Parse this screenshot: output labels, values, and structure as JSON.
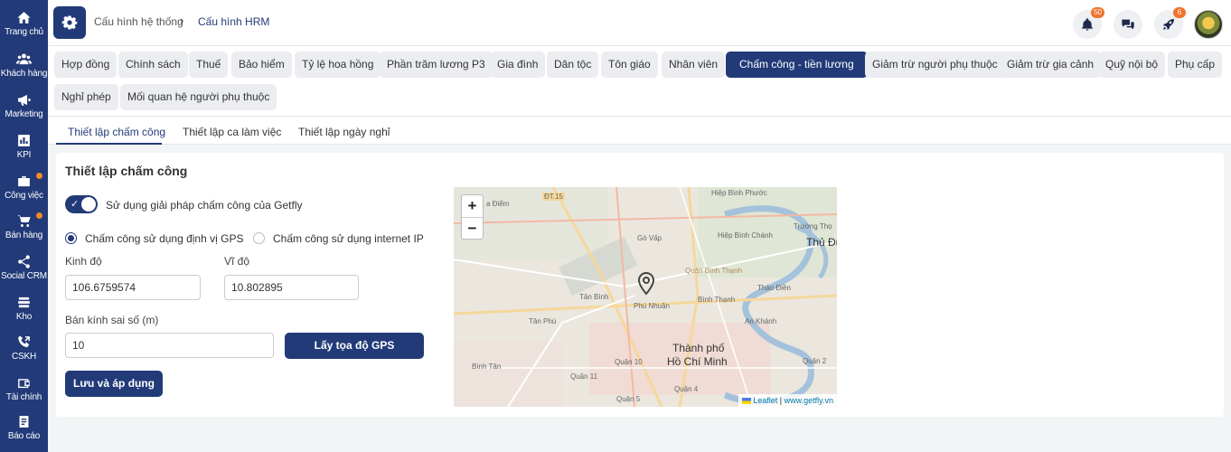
{
  "sidebar": {
    "items": [
      {
        "label": "Trang chủ",
        "icon": "home-icon"
      },
      {
        "label": "Khách hàng",
        "icon": "users-icon"
      },
      {
        "label": "Marketing",
        "icon": "megaphone-icon"
      },
      {
        "label": "KPI",
        "icon": "chart-icon"
      },
      {
        "label": "Công việc",
        "icon": "briefcase-icon"
      },
      {
        "label": "Bán hàng",
        "icon": "cart-icon"
      },
      {
        "label": "Social CRM",
        "icon": "share-icon"
      },
      {
        "label": "Kho",
        "icon": "warehouse-icon"
      },
      {
        "label": "CSKH",
        "icon": "phone-icon"
      },
      {
        "label": "Tài chính",
        "icon": "wallet-icon"
      },
      {
        "label": "Báo cáo",
        "icon": "report-icon"
      }
    ]
  },
  "header": {
    "breadcrumb_parent": "Cấu hình hệ thống",
    "breadcrumb_sep": "›",
    "breadcrumb_current": "Cấu hình HRM",
    "notifications_count": "50",
    "rocket_count": "6"
  },
  "chips": [
    "Hợp đồng",
    "Chính sách",
    "Thuế",
    "Bảo hiểm",
    "Tỷ lệ hoa hồng",
    "Phần trăm lương P3",
    "Gia đình",
    "Dân tộc",
    "Tôn giáo",
    "Nhân viên",
    "Chấm công - tiền lương",
    "Giảm trừ người phụ thuộc",
    "Giảm trừ gia cảnh",
    "Quỹ nội bộ",
    "Phụ cấp",
    "Nghỉ phép",
    "Mối quan hệ người phụ thuộc"
  ],
  "active_chip": "Chấm công - tiền lương",
  "subtabs": [
    "Thiết lập chấm công",
    "Thiết lập ca làm việc",
    "Thiết lập ngày nghỉ"
  ],
  "form": {
    "title": "Thiết lập chấm công",
    "toggle_label": "Sử dụng giải pháp chấm công của Getfly",
    "toggle_on": true,
    "radio_gps": "Chấm công sử dụng định vị GPS",
    "radio_ip": "Chấm công sử dụng internet IP",
    "longitude_label": "Kinh độ",
    "longitude_value": "106.6759574",
    "latitude_label": "Vĩ độ",
    "latitude_value": "10.802895",
    "radius_label": "Bán kính sai số (m)",
    "radius_value": "10",
    "gps_button": "Lấy tọa độ GPS",
    "save_button": "Lưu và áp dụng"
  },
  "map": {
    "zoom_in": "+",
    "zoom_out": "−",
    "labels": [
      "ĐT.15",
      "a Điểm",
      "Hiệp Bình Phước",
      "Hiệp Bình Chánh",
      "Trường Thọ",
      "Thủ Đức",
      "Gò Vấp",
      "Quận Bình Thạnh",
      "Tân Bình",
      "Phú Nhuận",
      "Bình Thạnh",
      "Thảo Điền",
      "Tân Phú",
      "An Khánh",
      "Thành phố",
      "Hồ Chí Minh",
      "Quận 10",
      "Bình Tân",
      "Quận 11",
      "Quận 4",
      "Quận 5",
      "Quận 2"
    ],
    "attribution_leaflet": "Leaflet",
    "attribution_sep": " | ",
    "attribution_site": "www.getfly.vn"
  }
}
